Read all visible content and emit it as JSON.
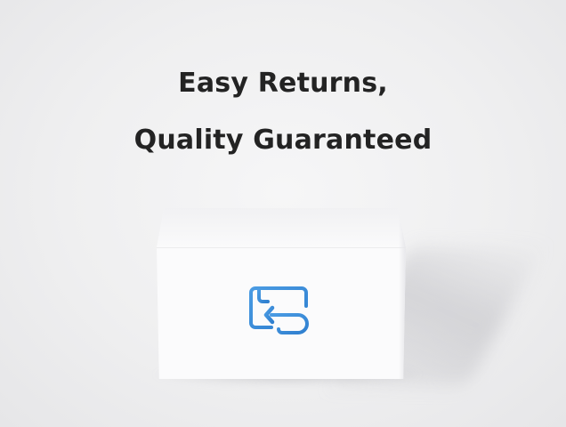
{
  "headline": {
    "line1": "Easy Returns,",
    "line2": "Quality Guaranteed"
  },
  "icons": {
    "box_icon": "return-arrow-box-icon"
  },
  "colors": {
    "heading_text": "#232323",
    "icon_blue": "#3d8ddc",
    "background": "#efeff0",
    "box": "#fbfbfc"
  }
}
